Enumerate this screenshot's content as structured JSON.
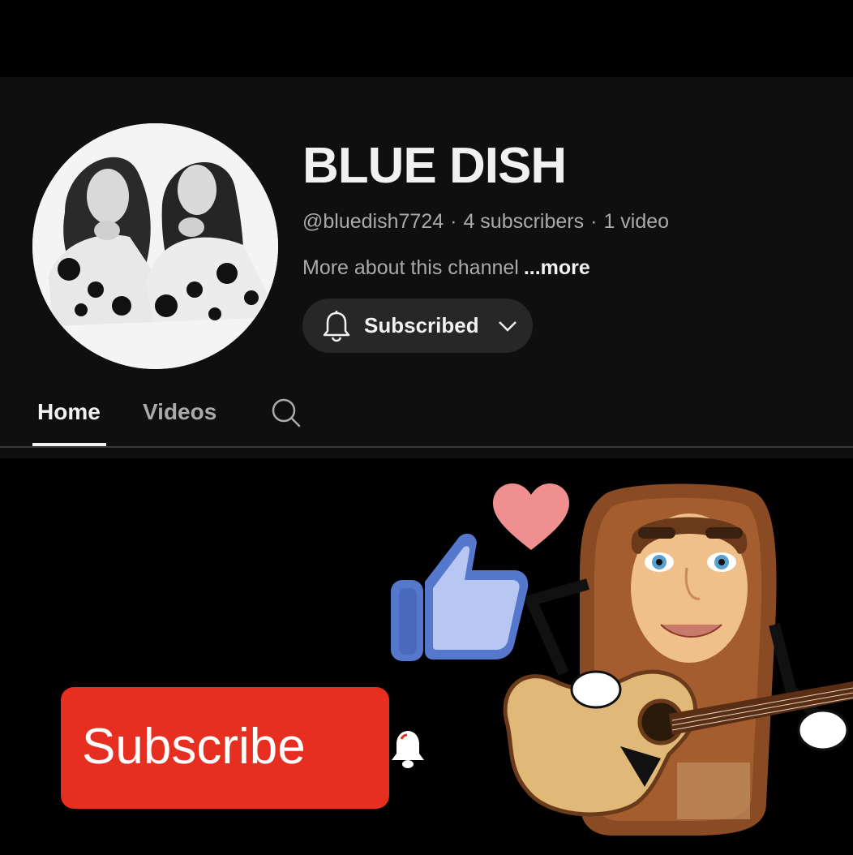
{
  "channel": {
    "name": "BLUE DISH",
    "handle": "@bluedish7724",
    "subscribers": "4 subscribers",
    "videos": "1 video",
    "separator": "·",
    "about": "More about this channel",
    "more": "...more",
    "avatar_icon": "channel-avatar-photo"
  },
  "subscribe_state": {
    "label": "Subscribed",
    "icon": "bell-icon",
    "menu_icon": "chevron-down-icon"
  },
  "tabs": [
    {
      "label": "Home",
      "selected": true
    },
    {
      "label": "Videos",
      "selected": false
    }
  ],
  "search_icon": "search-icon",
  "promo": {
    "subscribe_label": "Subscribe",
    "subscribe_color": "#e62f20",
    "like_icon": "thumbs-up-icon",
    "heart_icon": "heart-icon",
    "character": "guitar-character"
  },
  "colors": {
    "background": "#0f0f0f",
    "text_primary": "#f1f1f1",
    "text_secondary": "#aaaaaa",
    "button_bg": "#272727"
  }
}
